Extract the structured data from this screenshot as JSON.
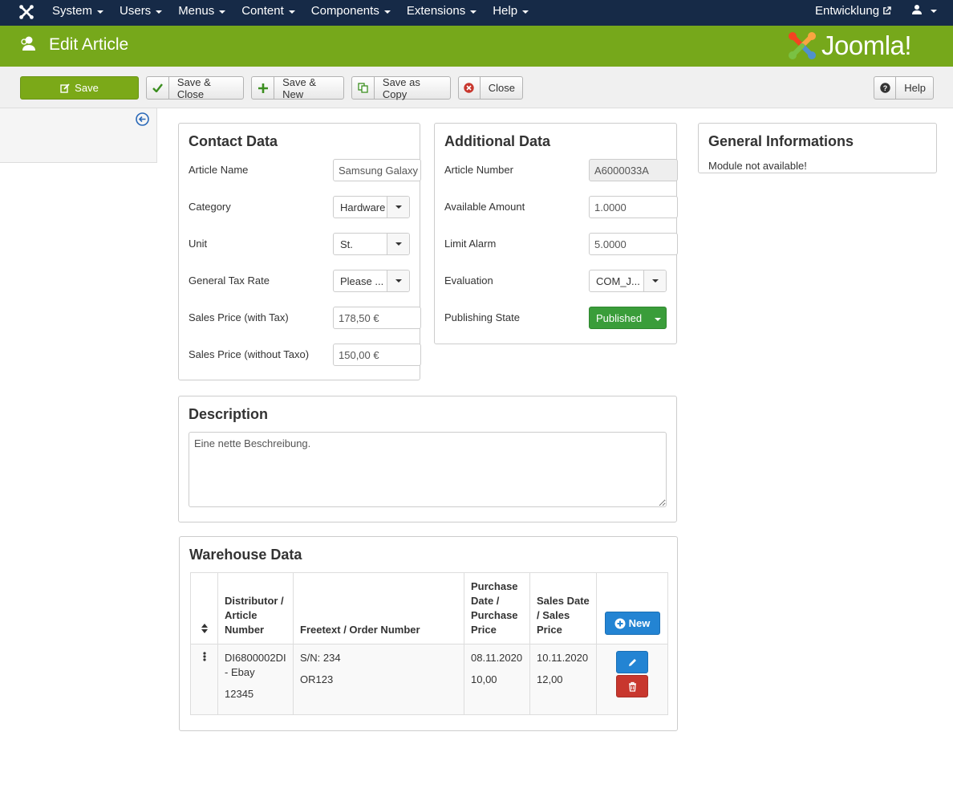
{
  "topnav": {
    "menu": [
      "System",
      "Users",
      "Menus",
      "Content",
      "Components",
      "Extensions",
      "Help"
    ],
    "site_link": "Entwicklung"
  },
  "header": {
    "title": "Edit Article",
    "brand": "Joomla!"
  },
  "toolbar": {
    "save": "Save",
    "save_close": "Save & Close",
    "save_new": "Save & New",
    "save_copy": "Save as Copy",
    "close": "Close",
    "help": "Help"
  },
  "contact": {
    "title": "Contact Data",
    "fields": [
      {
        "label": "Article Name",
        "value": "Samsung Galaxy"
      },
      {
        "label": "Category",
        "value": "Hardware"
      },
      {
        "label": "Unit",
        "value": "St."
      },
      {
        "label": "General Tax Rate",
        "value": "Please ..."
      },
      {
        "label": "Sales Price (with Tax)",
        "value": "178,50 €"
      },
      {
        "label": "Sales Price (without Taxo)",
        "value": "150,00 €"
      }
    ]
  },
  "additional": {
    "title": "Additional Data",
    "fields": [
      {
        "label": "Article Number",
        "value": "A6000033A"
      },
      {
        "label": "Available Amount",
        "value": "1.0000"
      },
      {
        "label": "Limit Alarm",
        "value": "5.0000"
      },
      {
        "label": "Evaluation",
        "value": "COM_J..."
      },
      {
        "label": "Publishing State",
        "value": "Published"
      }
    ]
  },
  "general": {
    "title": "General Informations",
    "message": "Module not available!"
  },
  "description": {
    "title": "Description",
    "text": "Eine nette Beschreibung."
  },
  "warehouse": {
    "title": "Warehouse Data",
    "headers": [
      "Distributor / Article Number",
      "Freetext / Order Number",
      "Purchase Date / Purchase Price",
      "Sales Date / Sales Price"
    ],
    "new_label": "New",
    "rows": [
      {
        "distributor": "DI6800002DI - Ebay",
        "article_number": "12345",
        "freetext": "S/N: 234",
        "order_number": "OR123",
        "purchase_date": "08.11.2020",
        "purchase_price": "10,00",
        "sales_date": "10.11.2020",
        "sales_price": "12,00"
      }
    ]
  },
  "colors": {
    "nav": "#162a47",
    "header": "#76a81b",
    "save": "#7ba918",
    "published": "#3a9d3a",
    "new": "#2384d3",
    "delete": "#c8372e"
  }
}
